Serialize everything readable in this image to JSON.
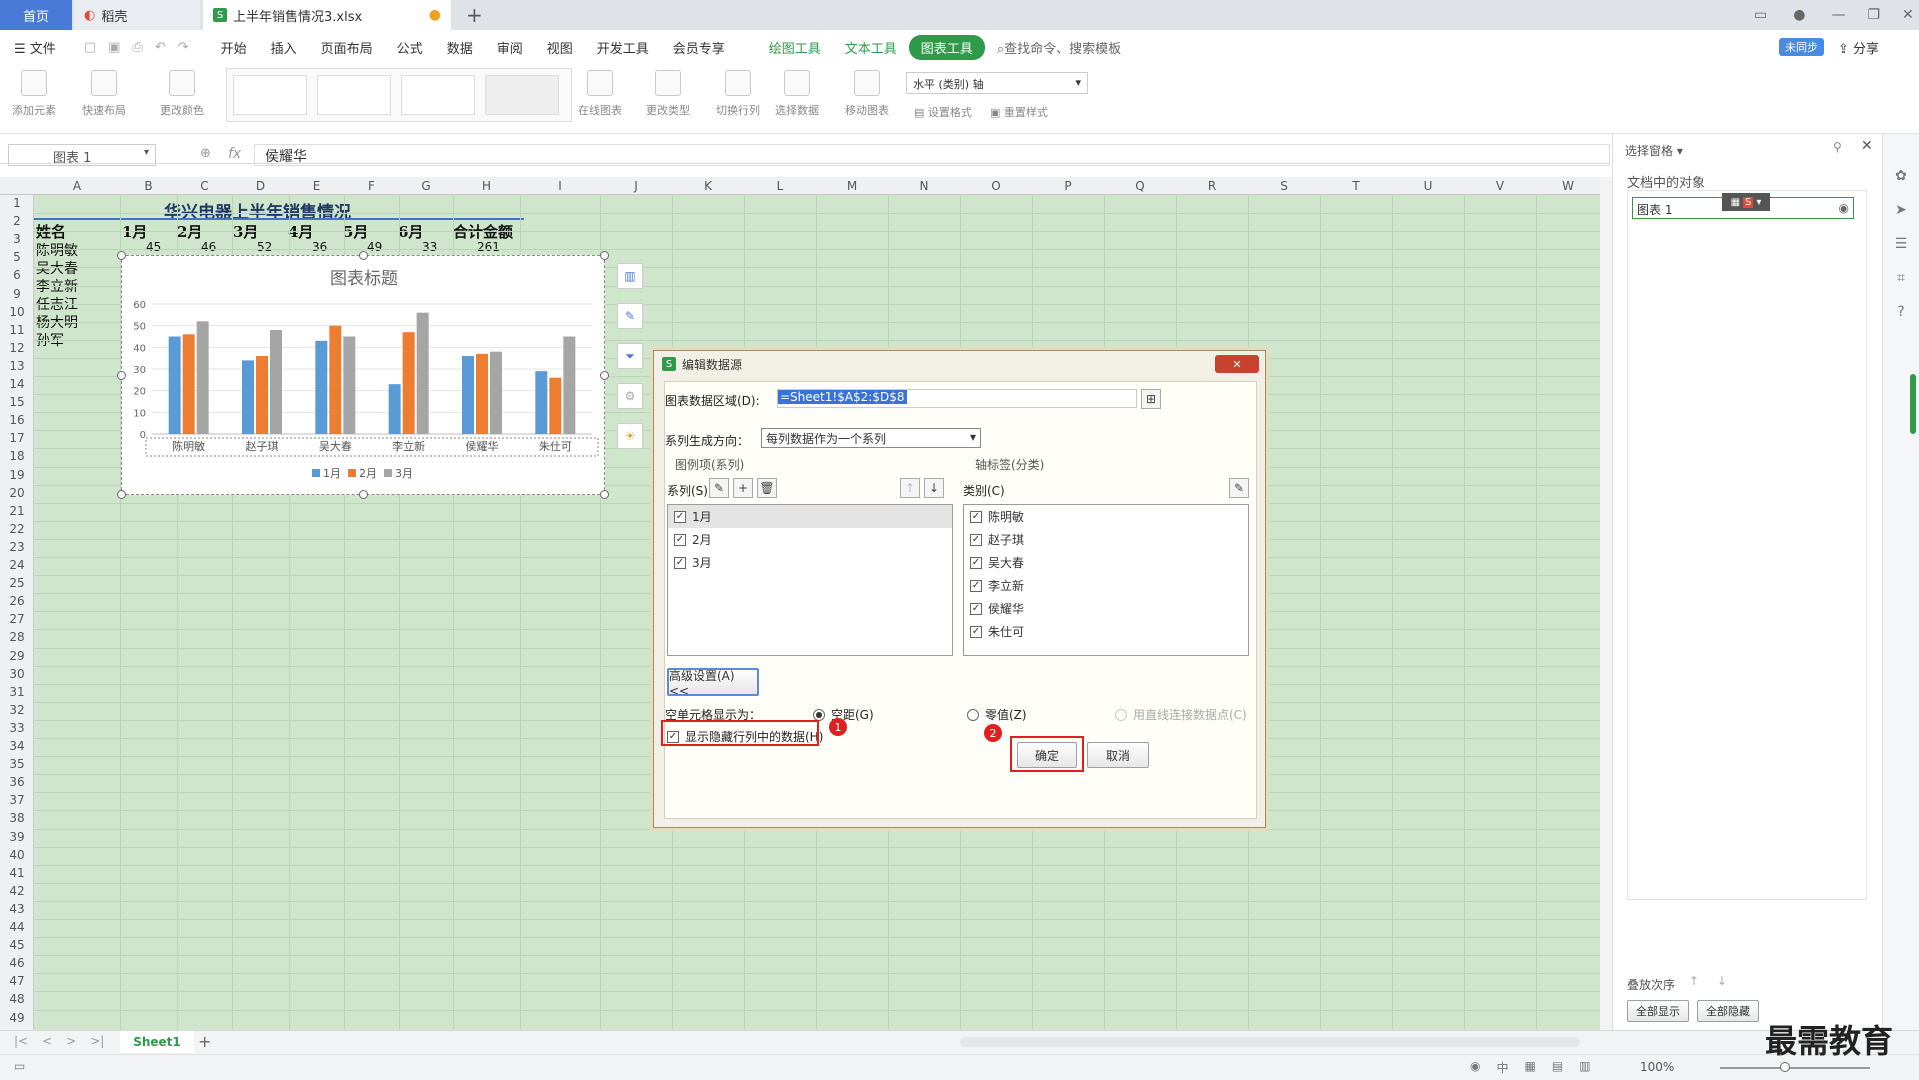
{
  "tabs": {
    "home": "首页",
    "docer": "稻壳",
    "file": "上半年销售情况3.xlsx",
    "modified_dot": "●",
    "add": "+"
  },
  "menu": {
    "file": "文件",
    "items": [
      "开始",
      "插入",
      "页面布局",
      "公式",
      "数据",
      "审阅",
      "视图",
      "开发工具",
      "会员专享"
    ],
    "tools": [
      "绘图工具",
      "文本工具"
    ],
    "active": "图表工具",
    "search": "查找命令、搜索模板",
    "cloud": "未同步",
    "share": "分享"
  },
  "ribbon": {
    "add_element": "添加元素",
    "quick_layout": "快速布局",
    "change_color": "更改颜色",
    "online_chart": "在线图表",
    "change_type": "更改类型",
    "switch_rowcol": "切换行列",
    "select_data": "选择数据",
    "move_chart": "移动图表",
    "axis_select": "水平 (类别) 轴",
    "set_format": "设置格式",
    "reset_style": "重置样式"
  },
  "formula": {
    "name_box": "图表 1",
    "fx": "fx",
    "content": "侯耀华"
  },
  "columns": [
    "A",
    "B",
    "C",
    "D",
    "E",
    "F",
    "G",
    "H",
    "I",
    "J",
    "K",
    "L",
    "M",
    "N",
    "O",
    "P",
    "Q",
    "R",
    "S",
    "T",
    "U",
    "V",
    "W"
  ],
  "rows": [
    "1",
    "2",
    "3",
    "5",
    "6",
    "9",
    "10",
    "11",
    "12",
    "13",
    "14",
    "15",
    "16",
    "17",
    "18",
    "19",
    "20",
    "21",
    "22",
    "23",
    "24",
    "25",
    "26",
    "27",
    "28",
    "29",
    "30",
    "31",
    "32",
    "33",
    "34",
    "35",
    "36",
    "37",
    "38",
    "39",
    "40",
    "41",
    "42",
    "43",
    "44",
    "45",
    "46",
    "47",
    "48",
    "49"
  ],
  "sheet": {
    "title": "华兴电器上半年销售情况",
    "header": [
      "姓名",
      "1月",
      "2月",
      "3月",
      "4月",
      "5月",
      "6月",
      "合计金额"
    ],
    "row3": [
      "陈明敏",
      "45",
      "46",
      "52",
      "36",
      "49",
      "33",
      "261"
    ],
    "names": [
      "吴大春",
      "李立新",
      "任志江",
      "杨大明",
      "孙军"
    ]
  },
  "chart_data": {
    "type": "bar",
    "title": "图表标题",
    "categories": [
      "陈明敏",
      "赵子琪",
      "吴大春",
      "李立新",
      "侯耀华",
      "朱仕可"
    ],
    "series": [
      {
        "name": "1月",
        "values": [
          45,
          34,
          43,
          23,
          36,
          29
        ],
        "color": "#5b9bd5"
      },
      {
        "name": "2月",
        "values": [
          46,
          36,
          50,
          47,
          37,
          26
        ],
        "color": "#ed7d31"
      },
      {
        "name": "3月",
        "values": [
          52,
          48,
          45,
          56,
          38,
          45
        ],
        "color": "#a5a5a5"
      }
    ],
    "ylim": [
      0,
      60
    ],
    "yticks": [
      "0",
      "10",
      "20",
      "30",
      "40",
      "50",
      "60"
    ],
    "legend": "bottom"
  },
  "dialog": {
    "title": "编辑数据源",
    "range_label": "图表数据区域(D):",
    "range_value": "=Sheet1!$A$2:$D$8",
    "direction_label": "系列生成方向：",
    "direction_value": "每列数据作为一个系列",
    "legend_group": "图例项(系列)",
    "axis_group": "轴标签(分类)",
    "series_label": "系列(S)",
    "category_label": "类别(C)",
    "series_items": [
      "1月",
      "2月",
      "3月"
    ],
    "category_items": [
      "陈明敏",
      "赵子琪",
      "吴大春",
      "李立新",
      "侯耀华",
      "朱仕可"
    ],
    "advanced": "高级设置(A) <<",
    "empty_label": "空单元格显示为：",
    "opt_gap": "空距(G)",
    "opt_zero": "零值(Z)",
    "opt_connect": "用直线连接数据点(C)",
    "show_hidden": "显示隐藏行列中的数据(H)",
    "ok": "确定",
    "cancel": "取消",
    "badge1": "1",
    "badge2": "2"
  },
  "pane": {
    "title": "选择窗格",
    "objects_label": "文档中的对象",
    "item": "图表 1",
    "order_label": "叠放次序",
    "show_all": "全部显示",
    "hide_all": "全部隐藏"
  },
  "bottom": {
    "sheet_tab": "Sheet1",
    "zoom": "100%",
    "watermark": "最需教育"
  }
}
